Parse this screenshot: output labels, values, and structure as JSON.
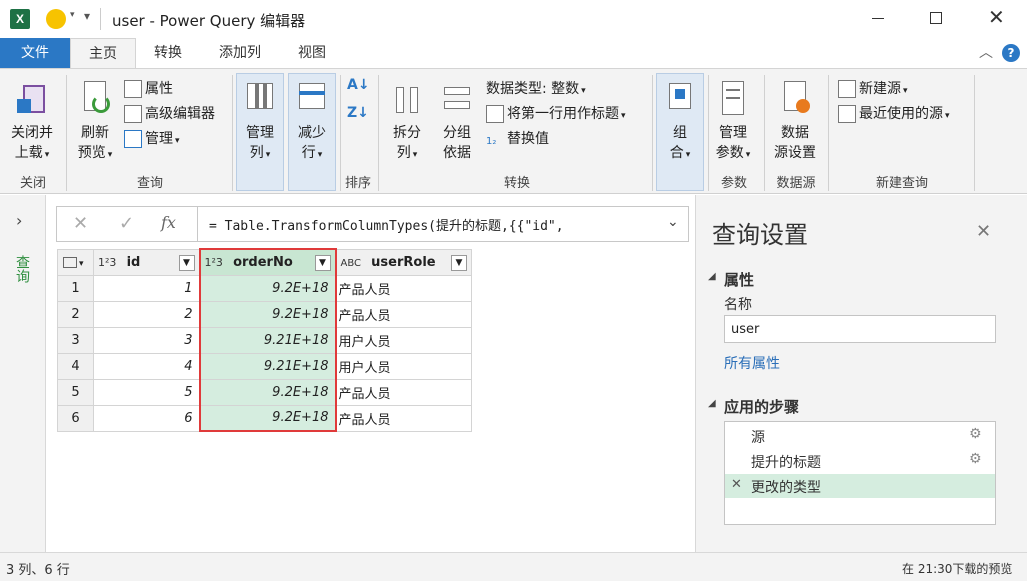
{
  "window": {
    "title": "user - Power Query 编辑器"
  },
  "tabs": {
    "file": "文件",
    "home": "主页",
    "transform": "转换",
    "add_column": "添加列",
    "view": "视图"
  },
  "ribbon": {
    "close": {
      "label1": "关闭并",
      "label2": "上载",
      "group": "关闭"
    },
    "query": {
      "refresh1": "刷新",
      "refresh2": "预览",
      "properties": "属性",
      "advanced_editor": "高级编辑器",
      "manage": "管理",
      "group": "查询"
    },
    "columns": {
      "manage1": "管理",
      "manage2": "列"
    },
    "rows": {
      "reduce1": "减少",
      "reduce2": "行"
    },
    "sort": {
      "group": "排序"
    },
    "transform": {
      "split1": "拆分",
      "split2": "列",
      "groupby1": "分组",
      "groupby2": "依据",
      "datatype": "数据类型: 整数",
      "first_row_header": "将第一行用作标题",
      "replace_values": "替换值",
      "group": "转换"
    },
    "combine": {
      "label1": "组",
      "label2": "合"
    },
    "params": {
      "label1": "管理",
      "label2": "参数",
      "group": "参数"
    },
    "datasource": {
      "label1": "数据",
      "label2": "源设置",
      "group": "数据源"
    },
    "newquery": {
      "new_source": "新建源",
      "recent_sources": "最近使用的源",
      "group": "新建查询"
    }
  },
  "left_pane": {
    "label": "查询"
  },
  "formula_bar": {
    "formula": "= Table.TransformColumnTypes(提升的标题,{{\"id\","
  },
  "table": {
    "columns": [
      {
        "type": "1²3",
        "name": "id"
      },
      {
        "type": "1²3",
        "name": "orderNo"
      },
      {
        "type": "ABC",
        "name": "userRole"
      }
    ],
    "rows": [
      {
        "n": "1",
        "id": "1",
        "orderNo": "9.2E+18",
        "userRole": "产品人员"
      },
      {
        "n": "2",
        "id": "2",
        "orderNo": "9.2E+18",
        "userRole": "产品人员"
      },
      {
        "n": "3",
        "id": "3",
        "orderNo": "9.21E+18",
        "userRole": "用户人员"
      },
      {
        "n": "4",
        "id": "4",
        "orderNo": "9.21E+18",
        "userRole": "用户人员"
      },
      {
        "n": "5",
        "id": "5",
        "orderNo": "9.2E+18",
        "userRole": "产品人员"
      },
      {
        "n": "6",
        "id": "6",
        "orderNo": "9.2E+18",
        "userRole": "产品人员"
      }
    ]
  },
  "query_settings": {
    "title": "查询设置",
    "properties_header": "属性",
    "name_label": "名称",
    "name_value": "user",
    "all_properties": "所有属性",
    "applied_steps_header": "应用的步骤",
    "steps": [
      {
        "label": "源"
      },
      {
        "label": "提升的标题"
      },
      {
        "label": "更改的类型"
      }
    ]
  },
  "status": {
    "left": "3 列、6 行",
    "right": "在 21:30下载的预览"
  },
  "colors": {
    "accent": "#2b78c5",
    "highlight_col": "#d5eddf",
    "red_box": "#e03a3a",
    "link": "#2b6fb8",
    "step_selected": "#d5eddf"
  }
}
